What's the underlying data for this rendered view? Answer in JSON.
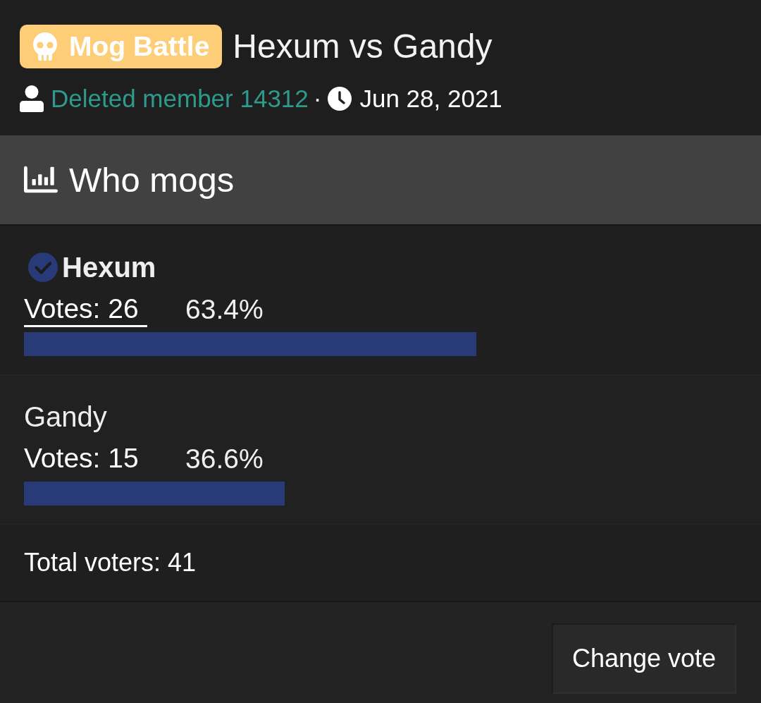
{
  "thread": {
    "prefix": "Mog Battle",
    "title": "Hexum vs Gandy",
    "author": "Deleted member 14312",
    "separator": "·",
    "date": "Jun 28, 2021"
  },
  "poll": {
    "title": "Who mogs",
    "options": [
      {
        "name": "Hexum",
        "selected": true,
        "votes": {
          "text": "Votes: 26",
          "hovered": true
        },
        "percent": "63.4%",
        "level": 0.634
      },
      {
        "name": "Gandy",
        "selected": false,
        "votes": {
          "text": "Votes: 15",
          "hovered": false
        },
        "percent": "36.6%",
        "level": 0.366
      }
    ],
    "total": "Total voters: 41",
    "button": "Change vote"
  }
}
